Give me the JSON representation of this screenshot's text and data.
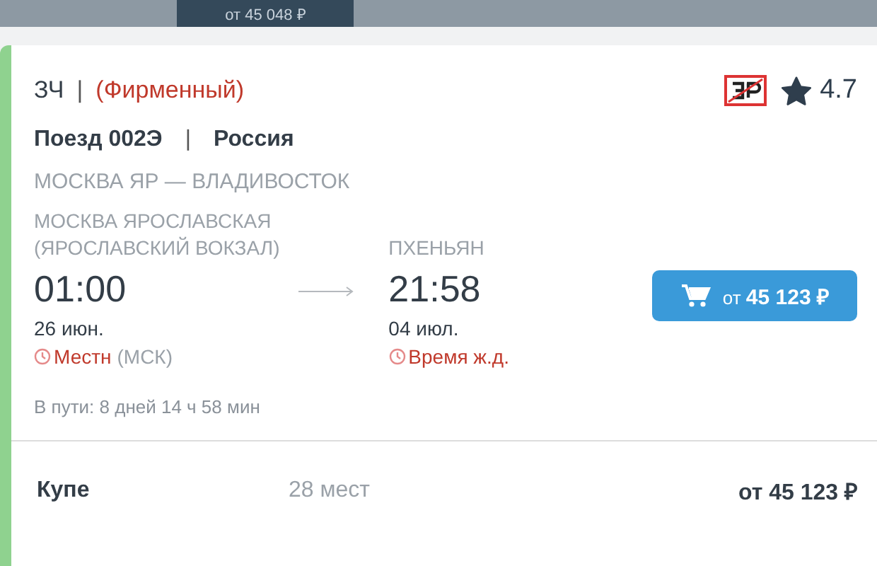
{
  "top_tab": {
    "label": "от 45 048 ₽"
  },
  "train": {
    "category": "ЗЧ",
    "separator": "|",
    "brand": "(Фирменный)",
    "rating": "4.7",
    "number": "Поезд 002Э",
    "divider": "|",
    "country": "Россия",
    "route": "МОСКВА ЯР — ВЛАДИВОСТОК"
  },
  "departure": {
    "station": "МОСКВА ЯРОСЛАВСКАЯ (ЯРОСЛАВСКИЙ ВОКЗАЛ)",
    "time": "01:00",
    "date": "26 июн.",
    "timezone": "Местн",
    "timezone_note": "(МСК)"
  },
  "arrival": {
    "station": "ПХЕНЬЯН",
    "time": "21:58",
    "date": "04 июл.",
    "timezone": "Время ж.д."
  },
  "buy_button": {
    "prefix": "от",
    "price": "45 123 ₽"
  },
  "duration": "В пути: 8 дней 14 ч 58 мин",
  "classes": [
    {
      "name": "Купе",
      "seats": "28 мест",
      "price": "от 45 123 ₽"
    }
  ]
}
